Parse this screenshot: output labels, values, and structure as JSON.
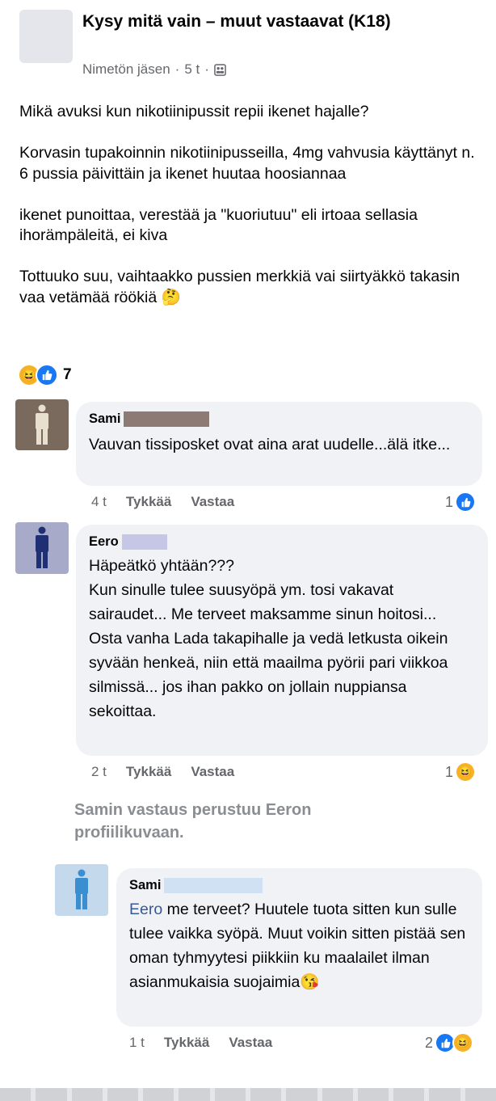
{
  "post": {
    "group_title": "Kysy mitä vain – muut vastaavat (K18)",
    "author": "Nimetön jäsen",
    "separator": "·",
    "time": "5 t",
    "paragraphs": [
      "Mikä avuksi kun nikotiinipussit repii ikenet hajalle?",
      "Korvasin tupakoinnin nikotiinipusseilla, 4mg vahvusia käyttänyt n. 6 pussia päivittäin ja ikenet huutaa hoosiannaa",
      "ikenet punoittaa, verestää ja \"kuoriutuu\" eli irtoaa sellasia ihorämpäleitä, ei kiva",
      "Tottuuko suu, vaihtaakko pussien merkkiä vai siirtyäkkö takasin vaa vetämää röökiä 🤔"
    ],
    "reaction_count": "7",
    "reaction_icons": [
      "haha-icon",
      "like-icon"
    ]
  },
  "comments": [
    {
      "name": "Sami",
      "text": "Vauvan tissiposket ovat aina arat uudelle...älä itke...",
      "time": "4 t",
      "like_label": "Tykkää",
      "reply_label": "Vastaa",
      "reaction_count": "1"
    },
    {
      "name": "Eero",
      "text_lines": [
        "Häpeätkö yhtään???",
        "Kun sinulle tulee suusyöpä ym. tosi vakavat sairaudet... Me terveet maksamme sinun hoitosi...",
        "Osta vanha Lada takapihalle ja vedä letkusta oikein syvään henkeä, niin että maailma pyörii pari viikkoa silmissä... jos ihan pakko on jollain nuppiansa sekoittaa."
      ],
      "time": "2 t",
      "like_label": "Tykkää",
      "reply_label": "Vastaa",
      "reaction_count": "1"
    }
  ],
  "annotation": "Samin vastaus perustuu Eeron profiilikuvaan.",
  "reply": {
    "name": "Sami",
    "mention": "Eero",
    "text": " me terveet? Huutele tuota sitten kun sulle tulee vaikka syöpä. Muut voikin sitten pistää sen oman tyhmyytesi piikkiin ku maalailet ilman asianmukaisia suojaimia",
    "emoji": "😘",
    "time": "1 t",
    "like_label": "Tykkää",
    "reply_label": "Vastaa",
    "reaction_count": "2"
  },
  "colors": {
    "brand_blue": "#1877f2",
    "bubble_bg": "#f0f2f5",
    "meta_gray": "#65676b",
    "annotation_gray": "#8a8d91",
    "sami_avatar_bg": "#7a6a5e",
    "eero_avatar_bg": "#a7abc9",
    "reply_avatar_bg": "#c5d9ec"
  }
}
